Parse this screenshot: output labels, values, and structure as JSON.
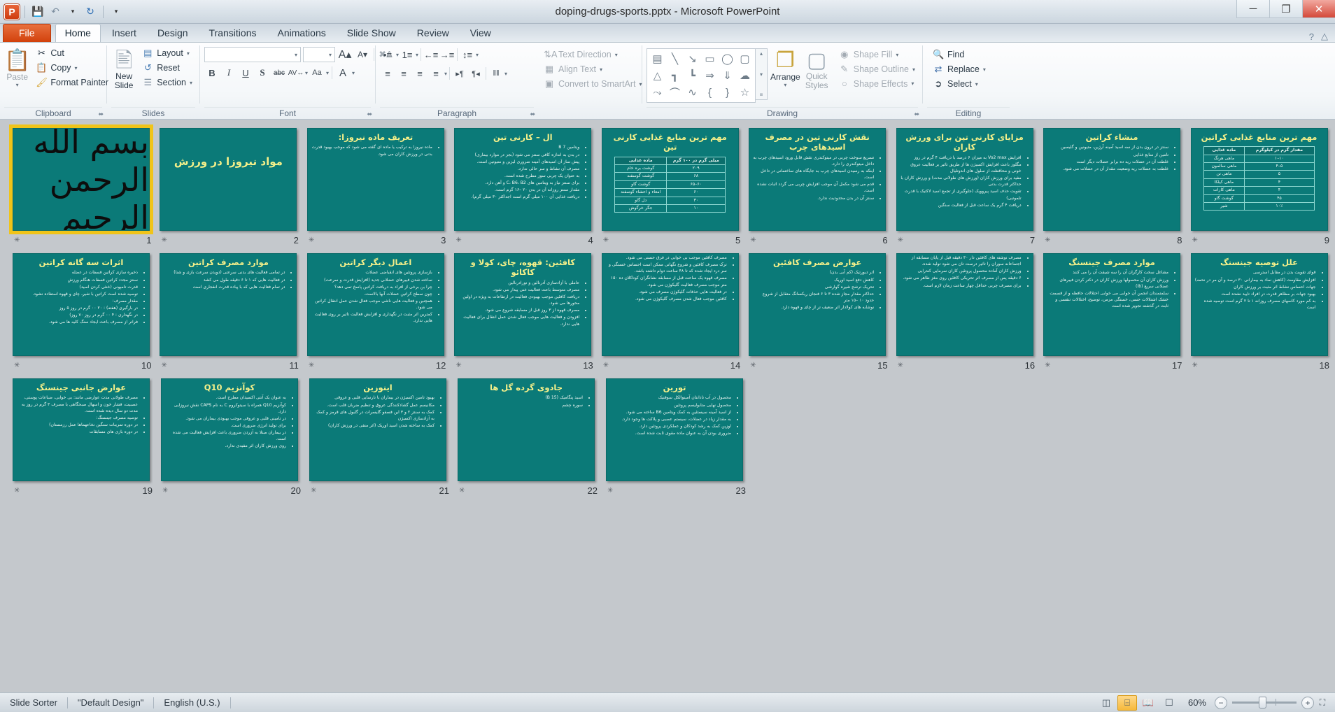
{
  "window": {
    "title": "doping-drugs-sports.pptx  -  Microsoft PowerPoint",
    "minimize": "─",
    "maximize": "❐",
    "close": "✕"
  },
  "quick_access": {
    "app_logo": "P",
    "save": "💾",
    "undo": "↶",
    "undo_caret": "▾",
    "redo": "↻",
    "customize": "▾"
  },
  "tabs": [
    {
      "label": "File",
      "active": false,
      "file": true
    },
    {
      "label": "Home",
      "active": true
    },
    {
      "label": "Insert",
      "active": false
    },
    {
      "label": "Design",
      "active": false
    },
    {
      "label": "Transitions",
      "active": false
    },
    {
      "label": "Animations",
      "active": false
    },
    {
      "label": "Slide Show",
      "active": false
    },
    {
      "label": "Review",
      "active": false
    },
    {
      "label": "View",
      "active": false
    }
  ],
  "tab_right": {
    "help": "?",
    "minimize_ribbon": "△"
  },
  "ribbon": {
    "clipboard": {
      "label": "Clipboard",
      "paste": "Paste",
      "paste_caret": "▾",
      "cut": "Cut",
      "copy": "Copy",
      "copy_caret": "▾",
      "format_painter": "Format Painter",
      "dialog_launcher": "⬌"
    },
    "slides": {
      "label": "Slides",
      "new_slide": "New",
      "new_slide2": "Slide",
      "new_slide_caret": "▾",
      "layout": "Layout",
      "reset": "Reset",
      "section": "Section",
      "caret": "▾"
    },
    "font": {
      "label": "Font",
      "font_name_value": "",
      "font_size_value": "",
      "grow": "A",
      "shrink": "A",
      "clear_formatting": "A⊘",
      "bold": "B",
      "italic": "I",
      "underline": "U",
      "shadow": "S",
      "strikethrough": "abc",
      "char_spacing": "AV",
      "change_case": "Aa",
      "font_color": "A",
      "dialog_launcher": "⬌"
    },
    "paragraph": {
      "label": "Paragraph",
      "bullets": "•≡",
      "numbering": "1≡",
      "decrease_indent": "←≡",
      "increase_indent": "→≡",
      "line_spacing": "↕≡",
      "align_left": "≡",
      "align_center": "≡",
      "align_right": "≡",
      "justify": "≡",
      "ltr": "▸¶",
      "rtl": "¶◂",
      "columns": "‖‖",
      "text_direction": "Text Direction",
      "align_text": "Align Text",
      "convert_to_smartart": "Convert to SmartArt",
      "dialog_launcher": "⬌"
    },
    "drawing": {
      "label": "Drawing",
      "shapes": [
        "▤",
        "╲",
        "↘",
        "▭",
        "◯",
        "▢",
        "△",
        "┓",
        "┗",
        "⇒",
        "⇓",
        "☁",
        "⤳",
        "⌒",
        "∿",
        "{",
        "}",
        "☆"
      ],
      "scroll_up": "▴",
      "scroll_down": "▾",
      "more": "≡",
      "arrange": "Arrange",
      "arrange_caret": "▾",
      "quick_styles": "Quick",
      "quick_styles2": "Styles",
      "quick_styles_caret": "▾",
      "shape_fill": "Shape Fill",
      "shape_outline": "Shape Outline",
      "shape_effects": "Shape Effects",
      "caret": "▾",
      "dialog_launcher": "⬌"
    },
    "editing": {
      "label": "Editing",
      "find": "Find",
      "replace": "Replace",
      "select": "Select",
      "caret": "▾"
    }
  },
  "slide_sorter": {
    "selected_slide": 1,
    "anim_icon": "✳",
    "slides": [
      {
        "number": "1",
        "kind": "image",
        "calligraphy": "بسم الله الرحمن الرحیم"
      },
      {
        "number": "2",
        "kind": "title-only",
        "title": "مواد نیروزا در ورزش"
      },
      {
        "number": "3",
        "kind": "bullets",
        "title": "تعریف ماده نیروزا:",
        "bullets": [
          "ماده نیروزا به ترکیب یا ماده ای گفته می شود که موجب بهبود قدرت بدنی در ورزش کاران می شود."
        ]
      },
      {
        "number": "4",
        "kind": "bullets",
        "title": "ال – کارنی تین",
        "bullets": [
          "ویتامین B 7",
          "در بدن به اندازه کافی سنتز می شود (بجز در موارد بیماری)",
          "پیش ساز آن اسیدهای آمینه ضروری لیزین و متیونین است.",
          "مصرف آن نشاط و سر حالی ندارد.",
          "به عنوان یک چربی سوز مطرح شده است.",
          "برای سنتز نیاز به ویتامین های C، B6، B2 و آهن دارد.",
          "مقدار سنتز روزانه آن در بدن ۲۰ –۱۶ گرم است.",
          "دریافت غذایی آن ۱۰۰ میلی گرم است اجداکثر ۳۰ میلی گرم)."
        ]
      },
      {
        "number": "5",
        "kind": "table",
        "title": "مهم ترین منابع غذایی کارنی تین",
        "table": {
          "headers": [
            "میلی گرم در ۱۰۰ گرم",
            "ماده غذایی"
          ],
          "rows": [
            [
              "۲۰۹",
              "گوشت بره خام"
            ],
            [
              "۶۸",
              "گوشت گوسفند"
            ],
            [
              "۶۰–۶۵",
              "گوشت گاو"
            ],
            [
              "۶۰",
              "امعاء و احشاء گوسفند"
            ],
            [
              "۳۰",
              "دل گاو"
            ],
            [
              "۱۰",
              "جگر خرگوش"
            ]
          ]
        }
      },
      {
        "number": "6",
        "kind": "bullets",
        "title": "نقش کارنی تین در مصرف اسیدهای چرب",
        "bullets": [
          "تسریع سوخت چربی در میتوکندری نقش قابل ورود اسیدهای چرب به داخل میتوکندری را دارد.",
          "اینکه به رسیدن اسیدهای چرب به جایگاه های ساختمانی در داخل است.",
          "قدم می شود مکمل آن موجب افزایش چربی می گردد اثبات نشده است.",
          "سنتز آن در بدن محدودیت ندارد."
        ]
      },
      {
        "number": "7",
        "kind": "bullets",
        "title": "مزایای کارنی تین برای ورزش کاران",
        "bullets": [
          "افزایش Vo2 max به میزان ۶ درصد با دریافت ۴ گرم در روز",
          "مگلوز باعث افزایش اکسیژن ها از طریق تاثیر بر فعالیت عروق خونی و محافظت از سلول های اندوتلیال",
          "مفید برای ورزش کاران (ورزش های طولانی مدت) و ورزش کاران با حداکثر قدرت بدنی",
          "تقویت حذف اسید پیروویک (جلوگیری از تجمع اسید لاکتیک با قدرت تلموتبی)",
          "دریافت ۴ گرم یک ساعت قبل از فعالیت سنگین"
        ]
      },
      {
        "number": "8",
        "kind": "bullets",
        "title": "منشاء کراتین",
        "bullets": [
          "سنتز در درون بدن از سه اسید آمینه آرژین، متیونین و گلیسین",
          "تامین از منابع غذایی",
          "غلظت آن در عضلات ریه ده برابر عضلات دیگر است",
          "غلظت به عضلات ریه وضعیت مقدار آن در عضلات می شود."
        ]
      },
      {
        "number": "9",
        "kind": "table",
        "title": "مهم ترین منابع غذایی کراتین",
        "table": {
          "headers": [
            "مقدار گرم در کیلوگرم",
            "ماده غذایی"
          ],
          "rows": [
            [
              "۱۰–۱",
              "ماهی هرنگ"
            ],
            [
              "۵–۴",
              "ماهی سالمون"
            ],
            [
              "۵",
              "ماهی تن"
            ],
            [
              "۴",
              "ماهی کیلکا"
            ],
            [
              "۴",
              "ماهی کارات"
            ],
            [
              "۴۵",
              "گوشت گاو"
            ],
            [
              "۱۰٪",
              "شیر"
            ]
          ]
        }
      },
      {
        "number": "10",
        "kind": "bullets",
        "title": "اثرات سه گانه کراتین",
        "bullets": [
          "ذخیره سازی کراتین فسفات در عضله",
          "سنتز مجدد کراتین فسفات هنگام ورزش",
          "قدرت تامپونی (خنثی کردن اسید)",
          "توصیه شده است کراتین با شیر، چای و قهوه استفاده نشود.",
          "مقدار مصرف:",
          "در بارگیری (هفته) : ۲۰ ۰۰ گرم در روز ۵ روز",
          "در نگهداری : ۴ ۰۰ گرم در روز ۷۰ روز)",
          "فراتر از مصرف باعث ایجاد سنگ کلیه ها می شود."
        ]
      },
      {
        "number": "11",
        "kind": "bullets",
        "title": "موارد مصرف کراتین",
        "bullets": [
          "در تمامی فعالیت های بدنی سرعتی (دویدن سرعت بازی و شنا)",
          "در فعالیت هایی که ۱ تا ۶ دقیقه طول می کشد",
          "در تمام فعالیت هایی که با پیاده قدرت انفجاری است"
        ]
      },
      {
        "number": "12",
        "kind": "bullets",
        "title": "اعمال دیگر کراتین",
        "bullets": [
          "بازسازی پروتئین های انقباضی عضلات",
          "ساخته شدن فیبرهای عضلانی جدید (افزایش قدرت و سرعت)",
          "چرا بن برخی از افراد به دریافت کراتین پاسخ تمی دهد؟",
          "چون سطح کراتین عضلات آنها بالاست.",
          "همچنین و فعالیت هایی ناشی موجب فعال شدن عمل انتقال کراتین می شود.",
          "کمترین اثر مثبت در نگهداری و افزایش فعالیت تاثیر بر روی فعالیت هایی ندارد."
        ]
      },
      {
        "number": "13",
        "kind": "bullets",
        "title": "کافئین: قهوه، چای، کولا و کاکائو",
        "bullets": [
          "عاملی با آزادسازی آدرنالین و نورادرنالین",
          "مصرف متوسط باعث فعالیت غنی پیدار می شود.",
          "دریافت کافئین موجب بهبودی فعالیت در ارتفاعات به ویژه در اولین محورها می شود.",
          "مصرف قهوه از ۳ روز قبل از مسابقه شروع می شود.",
          "افزودن و فعالیت هایی موجب فعال شدن عمل انتقال برای فعالیت هایی ندارد."
        ]
      },
      {
        "number": "14",
        "kind": "bullets",
        "title": "",
        "bullets": [
          "مصرف کافئین موجب بی خوابی در فرق حسنی می شود.",
          "ترک مصرف کافئین و شروع نگهانی ممکن است احساس خستگی و سر درد ایجاد شده که تا ۴۸ ساعت دوام داشته باشد.",
          "مصرف قهوه یک ساعت قبل از مسابقه نشانگران کوتاکلان ده ۱۵۰ متر موجب مصرف فعالیت گلیکوژن می شود.",
          "در فعالیت هایی حذفات گلیکوژن مصرف می شود.",
          "کافئین موجب فعال شدن مصرف گلیکوژن می شود."
        ]
      },
      {
        "number": "15",
        "kind": "bullets",
        "title": "عوارض مصرف کافئین",
        "bullets": [
          "اثر دیورتیک (کم آبی بدن)",
          "کاهش دفع اسید اوریک",
          "تحریک ترشح شیره گوارشی",
          "حداکثر مقدار مجاز شده ۳ تا ۶ فنجان ریکسانگ متقابل از شروع حدود ۱۰ –۱۵ متر",
          "نوشابه های کولادار اثر ضعیف تر از چای و قهوه دارد."
        ]
      },
      {
        "number": "16",
        "kind": "bullets",
        "title": "",
        "bullets": [
          "مصرف نوشته های کافئین دار ۳۰ دقیقه قبل از پایان مسابقه از اجتماعانه سوران را تاثیر درست تان می شود تولید شده.",
          "ورزش کاران آماده محصول پروتئین کاران سرمایی کندرایی",
          "۶ دقیقه پس از مصرف اثر تحریکی کافئین روی مغز ظاهر می شود.",
          "برای مصرف چربی حداقل چهار ساعت زمان لازم است."
        ]
      },
      {
        "number": "17",
        "kind": "bullets",
        "title": "موارد مصرف جینسنگ",
        "bullets": [
          "مشاغل سخت کارگران آن را سه شيفت آن را می کنند",
          "ورزش کاران آن محصولها ورزش کاران در دکتر کردن فیبرهای عضلانی سریع (Ib)",
          "سلمتمندان انجمن آن خوابی می خوابی اختلالات حافظه و از قسمت خشک اشتلالات حسی، خستگی مزمن، توضیح، اختلالات تنفسی و ثابت در گذشته تجویز شده است"
        ]
      },
      {
        "number": "18",
        "kind": "bullets",
        "title": "علل توصیه جینسنگ",
        "bullets": [
          "قوای تقویت بدن در مقابل استرسی",
          "افزایش مقاومت (کاهش نماد به بیمارانی ۳۰ درصد و آن مر در نحمه)",
          "جهات احساس نشاط اثر مثبت بر ورزش کاران",
          "بهبود جهات بر مظاهر قدرت در افراد تایید نشده است",
          "به کم مورد کاسهای مصرف روزانه ۱ تا ۲ گرم است توصیه شده است"
        ]
      },
      {
        "number": "19",
        "kind": "bullets",
        "title": "عوارض جانبی جینسنگ",
        "bullets": [
          "مصرف طولانی مدت عوارضی مانند: بی خوابی، ضباعات پوستی، عصبیت، فشار خون و اسهال صبحگاهی با مصرف ۳ گرم در روز به مدت دو سال دیده شده است.",
          "توصیه مصرف جینسنگ:",
          "در دوره تمرینات سنگین نخاعهماها عمل رزمستان)",
          "در دوره بازی های مسابقات"
        ]
      },
      {
        "number": "20",
        "kind": "bullets",
        "title": "کوآنزیم Q10",
        "bullets": [
          "به عنوان یک آنتی اکسیدان مطرح است.",
          "کوآنزیم Q10 همراه با سیتوکروم C به نام CAPS نقش نیروزایی دارد.",
          "در تامینی قلبی و عروقی موجب بهبودی بیماران می شود.",
          "برای تولید انرژی ضروری است.",
          "در بیماران مبتلا به آزردن ضروری باعث افزایش فعالیت می شده است.",
          "روی ورزش کاران اثر مفیدی ندارد."
        ]
      },
      {
        "number": "21",
        "kind": "bullets",
        "title": "اینوزین",
        "bullets": [
          "بهبود تامین اکسیژن در بیماران با نارسایی قلبی و عروقی",
          "مکانیسم عمل گشادکنندگی عروق و تنظیم ضربان قلب است.",
          "کمک به سنتز ۲ و ۳ این فسفو گلیسرات در گلبول های قرمز و کمک به آزادسازی اکسیژن",
          "کمک به ساخته شدن اسید اوریک (اثر منفی در ورزش کاران)"
        ]
      },
      {
        "number": "22",
        "kind": "bullets",
        "title": "جادوی گرده گل ها",
        "bullets": [
          "اسید پنگامیک (B 15)",
          "سوره چشم"
        ]
      },
      {
        "number": "23",
        "kind": "bullets",
        "title": "تورین",
        "bullets": [
          "محصول در آب نادانتان آمینوالکل سوفنیک",
          "محصول نهایی متابولیسم پروتئین",
          "از اسید آمینه سیستئین به کمک ویتامین B6 ساخته می شود.",
          "به مقدار زیاد در عضلات، سیستم عصبی و پلاکت ها وجود دارد.",
          "اوزین کمک به رشد کودکان و عملکردی پروتئین دارد.",
          "ضروری بودن آن به عنوان ماده مقوی ثابت شده است."
        ]
      }
    ]
  },
  "status_bar": {
    "view_mode": "Slide Sorter",
    "theme": "\"Default Design\"",
    "language": "English (U.S.)",
    "views": [
      {
        "name": "normal-view",
        "glyph": "◫",
        "active": false
      },
      {
        "name": "slide-sorter-view",
        "glyph": "⌸",
        "active": true
      },
      {
        "name": "reading-view",
        "glyph": "📖",
        "active": false
      },
      {
        "name": "slide-show-view",
        "glyph": "☐",
        "active": false
      }
    ],
    "zoom_level": "60%",
    "zoom_out": "−",
    "zoom_in": "+",
    "fit_to_window": "⛶"
  }
}
